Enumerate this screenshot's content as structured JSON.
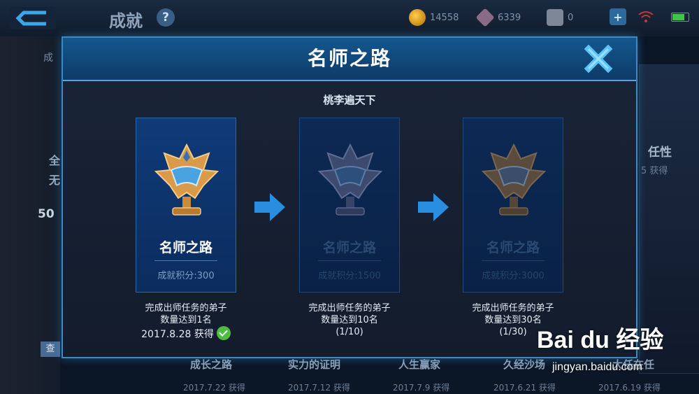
{
  "topbar": {
    "title": "成就",
    "help_icon": "?",
    "gold": "14558",
    "diamond": "6339",
    "coupon": "0",
    "icons": [
      "back-arrow-icon",
      "help-icon",
      "gold-coin-icon",
      "diamond-icon",
      "coupon-icon",
      "add-icon",
      "wifi-icon",
      "battery-icon"
    ]
  },
  "background": {
    "left_fragments": [
      "成",
      "全",
      "无",
      "50"
    ],
    "left_button": "查",
    "right_fragment": "任性",
    "right_count": "5 获得",
    "bottom_cards": [
      {
        "label": "成长之路",
        "date": "2017.7.22 获得"
      },
      {
        "label": "实力的证明",
        "date": "2017.7.12 获得"
      },
      {
        "label": "人生赢家",
        "date": "2017.7.9 获得"
      },
      {
        "label": "久经沙场",
        "date": "2017.6.21 获得"
      },
      {
        "label": "大任在任",
        "date": "2017.6.19 获得"
      }
    ]
  },
  "modal": {
    "title": "名师之路",
    "subtitle": "桃李遍天下",
    "close_icon": "close-x-icon",
    "stages": [
      {
        "name": "名师之路",
        "score": "成就积分:300",
        "desc1": "完成出师任务的弟子",
        "desc2": "数量达到1名",
        "status": "2017.8.28 获得",
        "achieved": true,
        "tier": "gold"
      },
      {
        "name": "名师之路",
        "score": "成就积分:1500",
        "desc1": "完成出师任务的弟子",
        "desc2": "数量达到10名",
        "status": "(1/10)",
        "achieved": false,
        "tier": "silver"
      },
      {
        "name": "名师之路",
        "score": "成就积分:3000",
        "desc1": "完成出师任务的弟子",
        "desc2": "数量达到30名",
        "status": "(1/30)",
        "achieved": false,
        "tier": "bronze"
      }
    ]
  },
  "watermark": {
    "logo": "Bai du 经验",
    "url": "jingyan.baidu.com"
  },
  "colors": {
    "accent_blue": "#3c89c4",
    "header_blue": "#14578f",
    "active_card": "#0f3b78",
    "check_green": "#4bbd3f"
  }
}
